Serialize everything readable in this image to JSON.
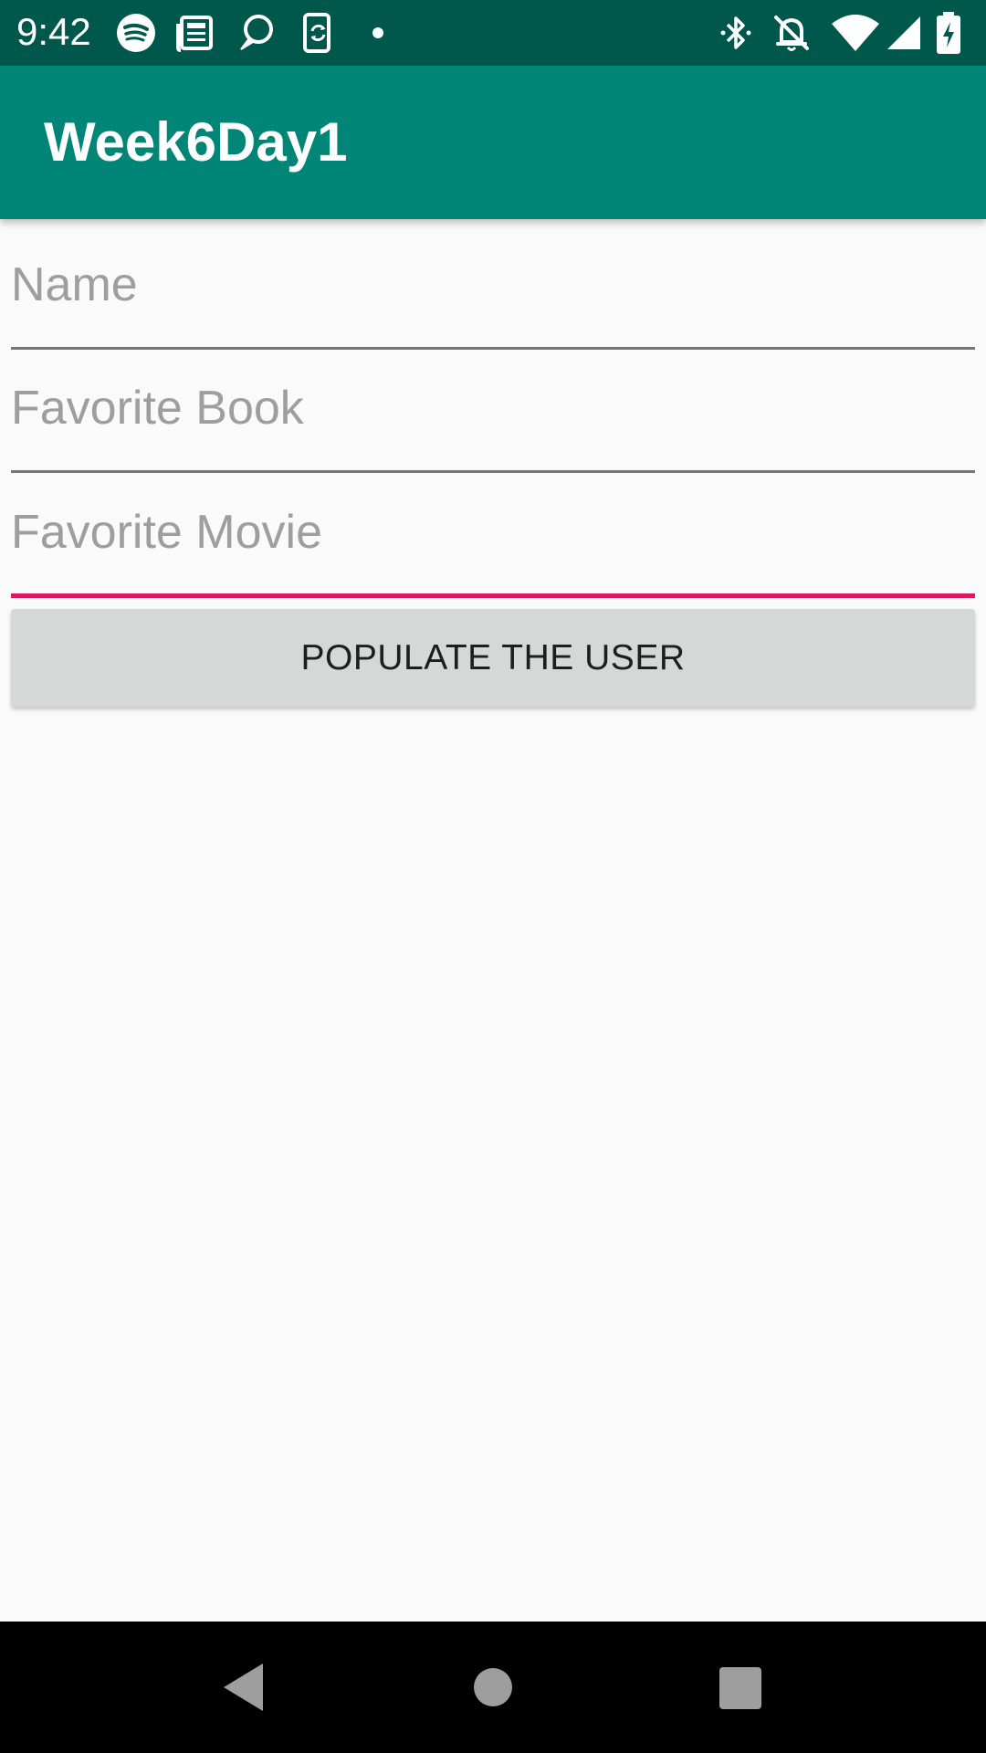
{
  "status_bar": {
    "time": "9:42",
    "left_icons": [
      "spotify-icon",
      "news-icon",
      "chat-bubble-icon",
      "phone-sync-icon",
      "notification-dot-icon"
    ],
    "right_icons": [
      "bluetooth-icon",
      "bell-off-icon",
      "wifi-icon",
      "cellular-signal-icon",
      "battery-charging-icon"
    ]
  },
  "app_bar": {
    "title": "Week6Day1",
    "color": "#008577"
  },
  "form": {
    "name": {
      "placeholder": "Name",
      "value": ""
    },
    "favorite_book": {
      "placeholder": "Favorite Book",
      "value": ""
    },
    "favorite_movie": {
      "placeholder": "Favorite Movie",
      "value": ""
    },
    "focused_field": "favorite_movie",
    "accent_color": "#d81b60",
    "populate_button_label": "POPULATE THE USER"
  },
  "nav_bar": {
    "buttons": [
      "back-icon",
      "home-icon",
      "recents-icon"
    ]
  },
  "colors": {
    "status_bar": "#00574b",
    "background": "#fafafa",
    "button": "#d6d7d7"
  }
}
